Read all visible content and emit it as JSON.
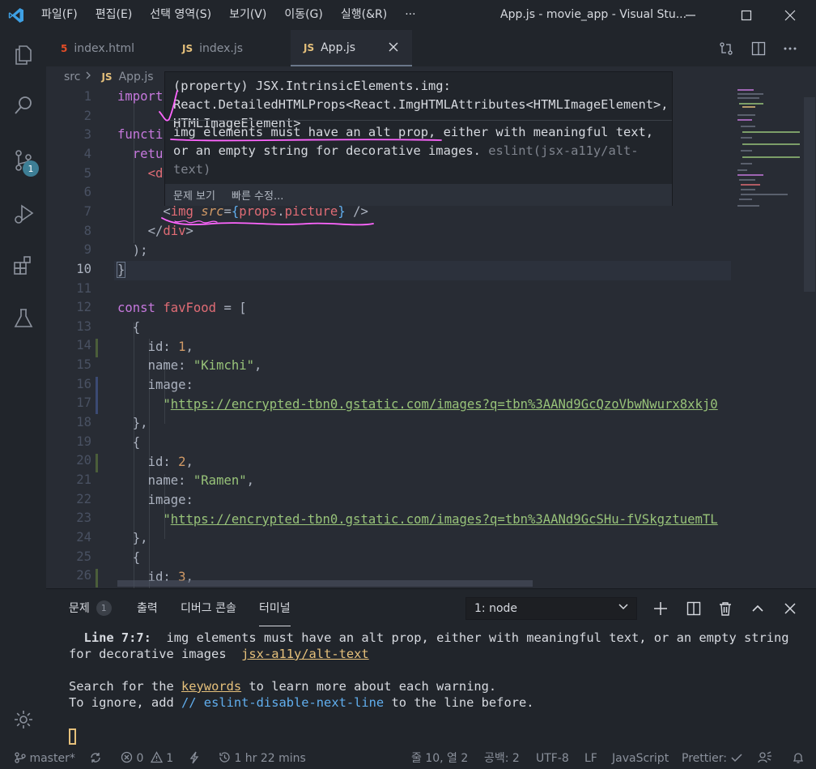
{
  "window": {
    "menu": [
      "파일(F)",
      "편집(E)",
      "선택 영역(S)",
      "보기(V)",
      "이동(G)",
      "실행(&R)",
      "···"
    ],
    "title": "App.js - movie_app - Visual Stu..."
  },
  "activity_bar": {
    "source_control_badge": "1"
  },
  "tabs": [
    {
      "label": "index.html",
      "icon": "html5-icon",
      "icon_text": "5"
    },
    {
      "label": "index.js",
      "icon": "js-icon",
      "icon_text": "JS"
    },
    {
      "label": "App.js",
      "icon": "js-icon",
      "icon_text": "JS",
      "active": true
    }
  ],
  "breadcrumb": {
    "folder": "src",
    "file_icon": "JS",
    "file": "App.js"
  },
  "editor": {
    "line_numbers": [
      "1",
      "2",
      "3",
      "4",
      "5",
      "6",
      "7",
      "8",
      "9",
      "10",
      "11",
      "12",
      "13",
      "14",
      "15",
      "16",
      "17",
      "18",
      "19",
      "20",
      "21",
      "22",
      "23",
      "24",
      "25",
      "26"
    ],
    "tokens": {
      "import": "import",
      "function_partial": "functi",
      "return_partial": "retu",
      "div_open_partial": "<d",
      "img_line": [
        "<",
        "img",
        " ",
        "src",
        "=",
        "{",
        "props",
        ".",
        "picture",
        "}",
        " />"
      ],
      "div_close": [
        "</",
        "div",
        ">"
      ],
      "paren_close": ");",
      "brace_close": "}",
      "const_line": [
        "const",
        " ",
        "favFood",
        " = ["
      ],
      "obj_open": "{",
      "obj_close": "},",
      "id_key": "id: ",
      "name_key": "name: ",
      "image_key": "image:",
      "items": [
        {
          "id": "1",
          "name": "\"Kimchi\"",
          "url": "https://encrypted-tbn0.gstatic.com/images?q=tbn%3AANd9GcQzoVbwNwurx8xkj0"
        },
        {
          "id": "2",
          "name": "\"Ramen\"",
          "url": "https://encrypted-tbn0.gstatic.com/images?q=tbn%3AANd9GcSHu-fVSkgztuemTL"
        },
        {
          "id": "3"
        }
      ]
    }
  },
  "hover": {
    "signature": "(property) JSX.IntrinsicElements.img: React.DetailedHTMLProps<React.ImgHTMLAttributes<HTMLImageElement>, HTMLImageElement>",
    "message": "img elements must have an alt prop, either with meaningful text, or an empty string for decorative images.",
    "source": "eslint(jsx-a11y/alt-text)",
    "actions": [
      "문제 보기",
      "빠른 수정..."
    ]
  },
  "panel": {
    "tabs": [
      "문제",
      "출력",
      "디버그 콘솔",
      "터미널"
    ],
    "problems_count": "1",
    "terminal_select": "1: node",
    "terminal": {
      "line_label": "Line 7:7:",
      "line_message": "img elements must have an alt prop, either with meaningful text, or an empty string for decorative images",
      "rule": "jsx-a11y/alt-text",
      "search_prefix": "Search for the ",
      "keywords": "keywords",
      "search_suffix": " to learn more about each warning.",
      "ignore_prefix": "To ignore, add ",
      "ignore_comment": "// eslint-disable-next-line",
      "ignore_suffix": " to the line before."
    }
  },
  "statusbar": {
    "branch": "master*",
    "errors": "0",
    "warnings": "1",
    "time": "1 hr 22 mins",
    "position": "줄 10, 열 2",
    "spaces": "공백: 2",
    "encoding": "UTF-8",
    "eol": "LF",
    "language": "JavaScript",
    "prettier": "Prettier:"
  },
  "colors": {
    "background": "#282c34",
    "chrome": "#21252b",
    "annotation": "#ff66ff",
    "keyword": "#c678dd",
    "string": "#98c379",
    "tag": "#e06c75"
  }
}
